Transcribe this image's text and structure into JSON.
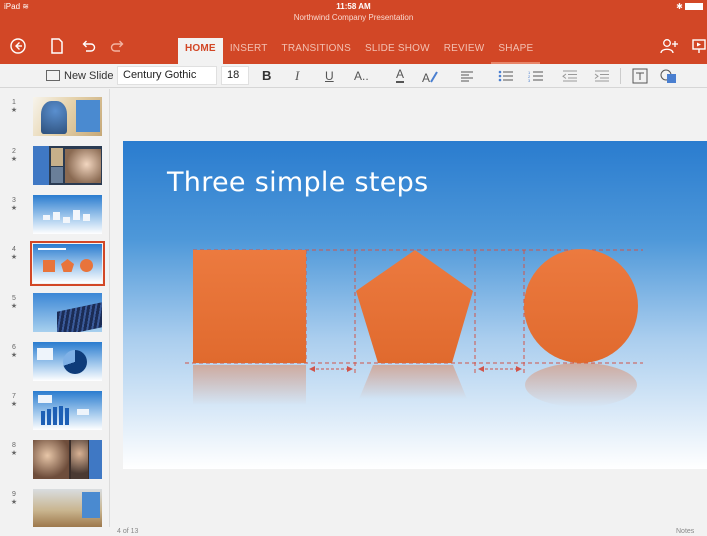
{
  "status": {
    "device": "iPad",
    "time": "11:58 AM"
  },
  "document": {
    "title": "Northwind Company Presentation"
  },
  "tabs": [
    {
      "label": "HOME",
      "active": true
    },
    {
      "label": "INSERT"
    },
    {
      "label": "TRANSITIONS"
    },
    {
      "label": "SLIDE SHOW"
    },
    {
      "label": "REVIEW"
    },
    {
      "label": "SHAPE"
    }
  ],
  "ribbon": {
    "new_slide": "New Slide",
    "font_name": "Century Gothic",
    "font_size": "18",
    "bold": "B",
    "italic": "I",
    "underline": "U",
    "text_effects": "A..",
    "font_color": "A"
  },
  "thumbnails": [
    {
      "num": "1",
      "star": "★"
    },
    {
      "num": "2",
      "star": "★"
    },
    {
      "num": "3",
      "star": "★"
    },
    {
      "num": "4",
      "star": "★",
      "selected": true
    },
    {
      "num": "5",
      "star": "★"
    },
    {
      "num": "6",
      "star": "★"
    },
    {
      "num": "7",
      "star": "★"
    },
    {
      "num": "8",
      "star": "★"
    },
    {
      "num": "9",
      "star": "★"
    }
  ],
  "slide": {
    "title": "Three simple steps"
  },
  "footer": {
    "slide_count": "4 of 13",
    "notes": "Notes"
  },
  "colors": {
    "accent": "#d24726",
    "shape": "#e8743b"
  }
}
